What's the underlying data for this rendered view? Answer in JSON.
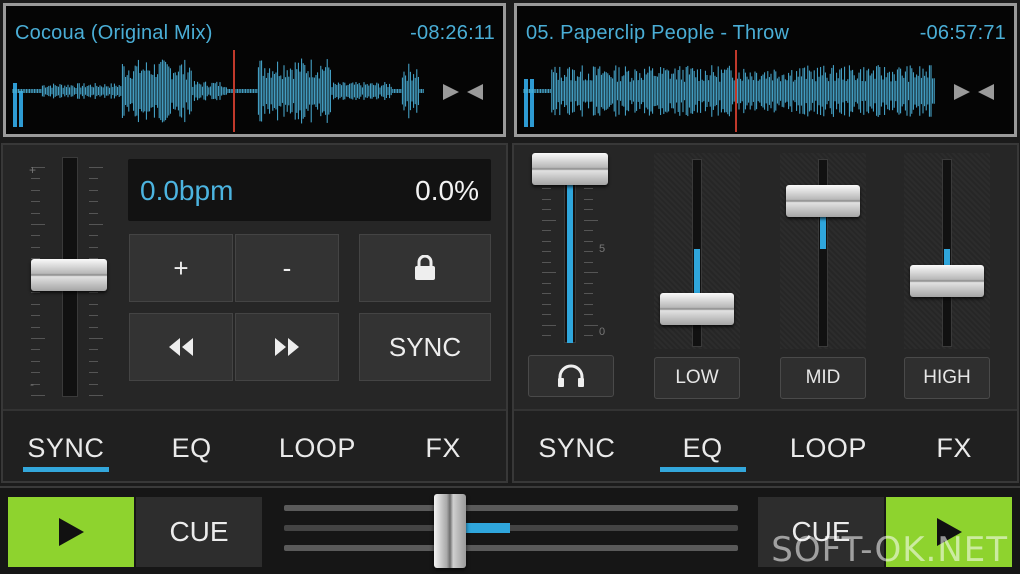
{
  "colors": {
    "accent": "#33a7db",
    "play": "#8ed32e",
    "waveform": "#4aaed6",
    "playhead": "#c0392b"
  },
  "decks": [
    {
      "title": "Cocoua (Original Mix)",
      "time": "-08:26:11"
    },
    {
      "title": "05. Paperclip People - Throw",
      "time": "-06:57:71"
    }
  ],
  "left_panel": {
    "bpm": "0.0bpm",
    "pitch_percent": "0.0%",
    "buttons": {
      "plus": "+",
      "minus": "-",
      "lock_icon": "lock-icon",
      "rewind_icon": "rewind-icon",
      "forward_icon": "fast-forward-icon",
      "sync": "SYNC"
    },
    "tabs": [
      "SYNC",
      "EQ",
      "LOOP",
      "FX"
    ],
    "active_tab": "SYNC"
  },
  "right_panel": {
    "headphones_icon": "headphones-icon",
    "eq_labels": {
      "low": "LOW",
      "mid": "MID",
      "high": "HIGH"
    },
    "volume_scale": [
      "5",
      "0"
    ],
    "tabs": [
      "SYNC",
      "EQ",
      "LOOP",
      "FX"
    ],
    "active_tab": "EQ"
  },
  "bottom": {
    "cue_left": "CUE",
    "cue_right": "CUE"
  },
  "watermark": "SOFT-OK.NET"
}
